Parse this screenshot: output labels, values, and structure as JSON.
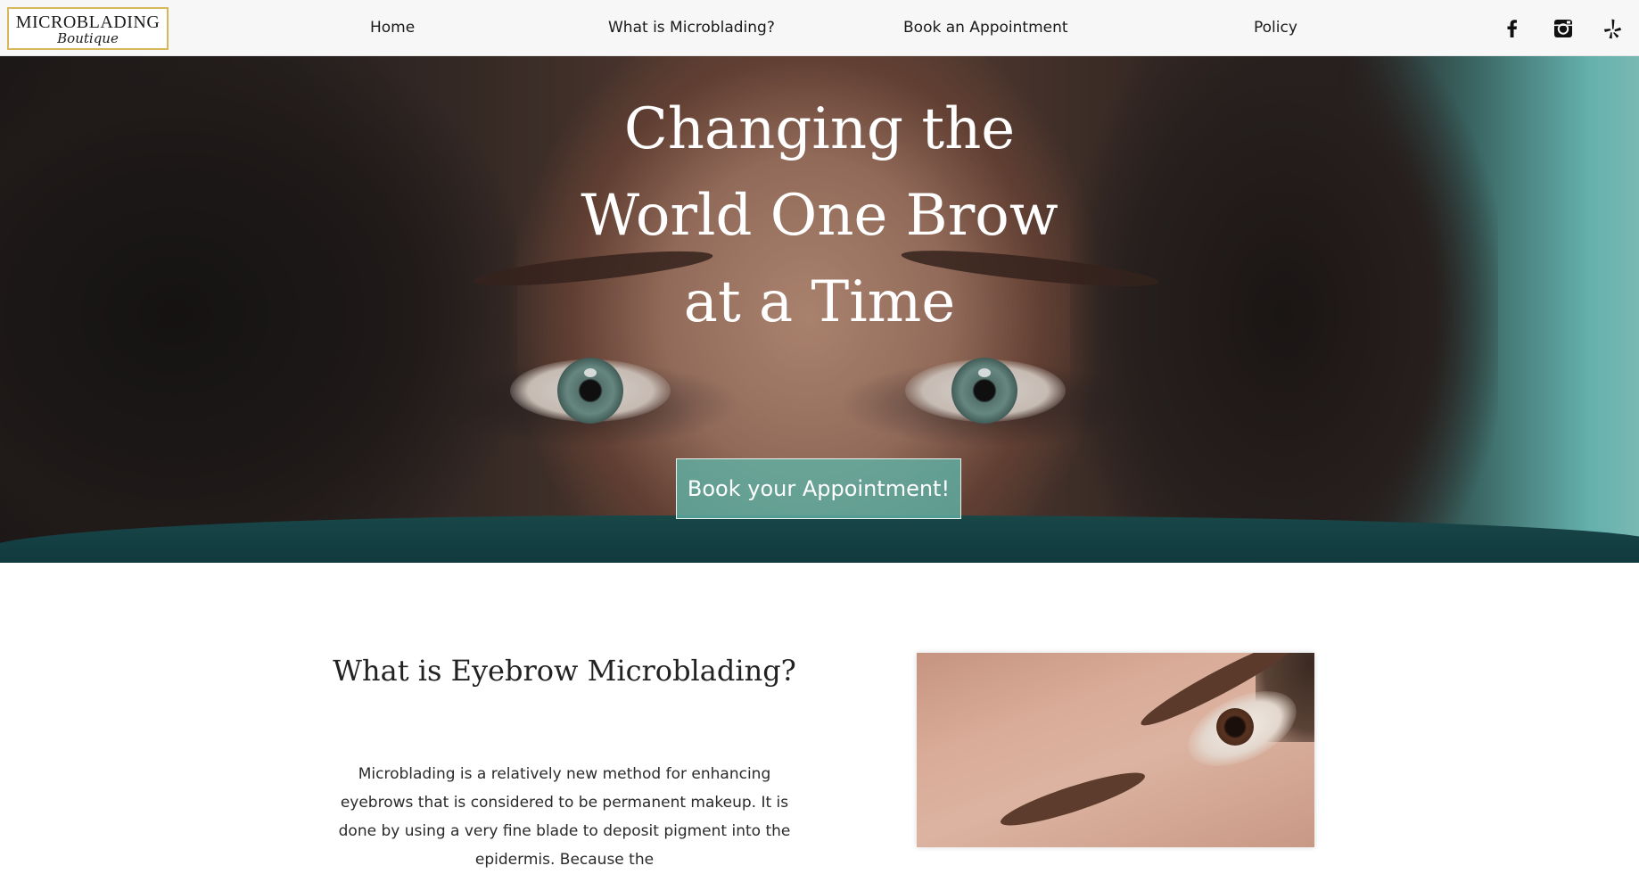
{
  "logo": {
    "line1": "MICROBLADING",
    "line2": "Boutique"
  },
  "nav": {
    "items": [
      {
        "label": "Home"
      },
      {
        "label": "What is Microblading?"
      },
      {
        "label": "Book an Appointment"
      },
      {
        "label": "Policy"
      }
    ]
  },
  "social": [
    {
      "icon": "facebook-icon"
    },
    {
      "icon": "instagram-icon"
    },
    {
      "icon": "yelp-icon"
    }
  ],
  "hero": {
    "title": "Changing the World One Brow at a Time",
    "cta_label": "Book your Appointment!"
  },
  "section": {
    "title": "What is Eyebrow Microblading?",
    "body": "Microblading is a relatively new method for enhancing eyebrows that is considered to be permanent makeup. It is done by using a very fine blade to deposit pigment into the epidermis. Because the"
  },
  "colors": {
    "accent": "#5fb0a4",
    "logo_border": "#d8b65a",
    "header_bg": "#f7f7f7",
    "text": "#222222"
  }
}
